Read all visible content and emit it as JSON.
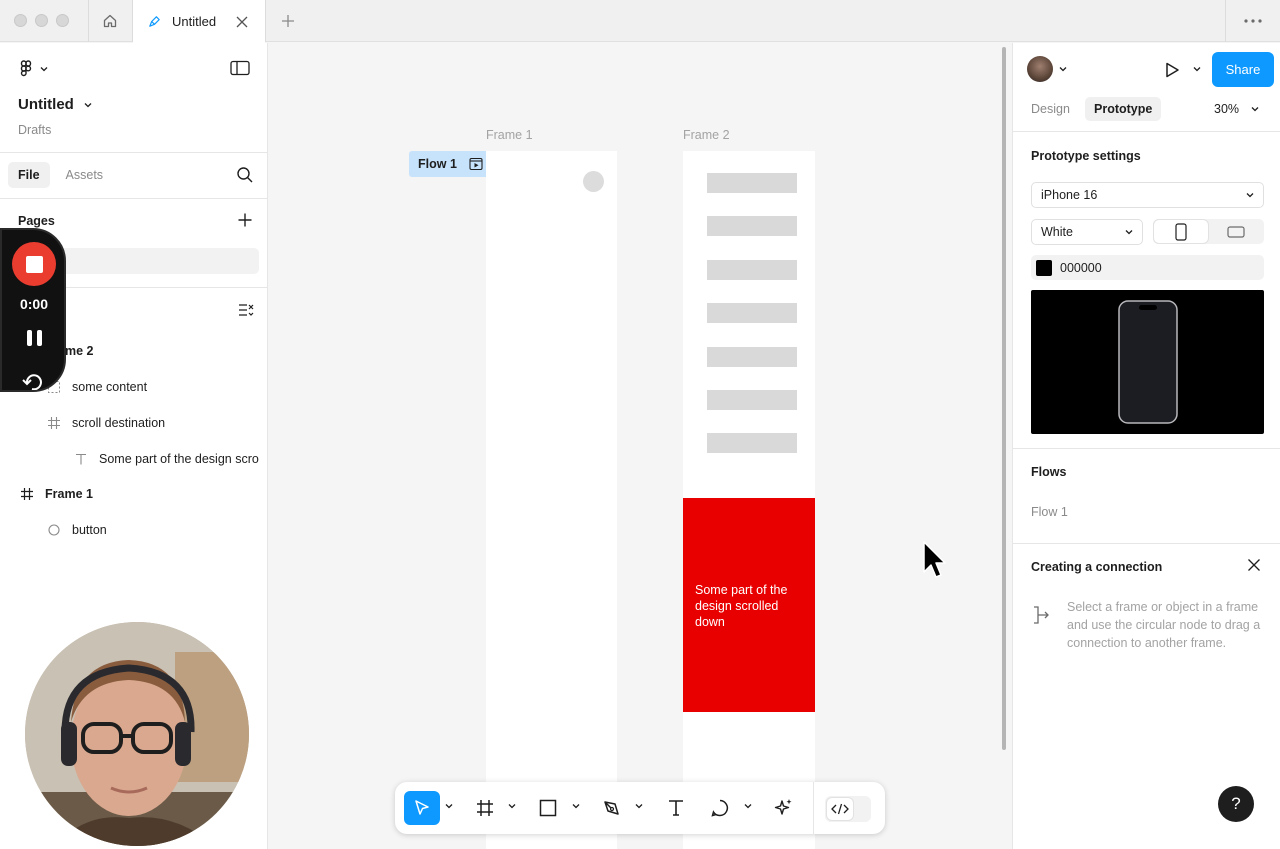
{
  "tab": {
    "title": "Untitled"
  },
  "file": {
    "name": "Untitled",
    "location": "Drafts"
  },
  "left_tabs": {
    "file": "File",
    "assets": "Assets"
  },
  "pages": {
    "label": "Pages"
  },
  "recording": {
    "time": "0:00"
  },
  "layers": [
    {
      "name": "Frame 2",
      "visible_text": "ame 2",
      "type": "frame",
      "depth": 0
    },
    {
      "name": "some content",
      "type": "section",
      "depth": 1
    },
    {
      "name": "scroll destination",
      "type": "frame",
      "depth": 1
    },
    {
      "name": "Some part of the design scrolled down",
      "visible_text": "Some part of the design scro",
      "type": "text",
      "depth": 2
    },
    {
      "name": "Frame 1",
      "type": "frame",
      "depth": 0
    },
    {
      "name": "button",
      "type": "ellipse",
      "depth": 1
    }
  ],
  "canvas": {
    "frame1_label": "Frame 1",
    "frame2_label": "Frame 2",
    "flow_chip": "Flow 1",
    "red_box_text": "Some part of the design scrolled down",
    "red_color": "#e80000"
  },
  "right": {
    "share": "Share",
    "tab_design": "Design",
    "tab_prototype": "Prototype",
    "zoom": "30%",
    "prototype_settings": "Prototype settings",
    "device": "iPhone 16",
    "model_color": "White",
    "background_hex": "000000",
    "flows_title": "Flows",
    "flow_item": "Flow 1",
    "connection_title": "Creating a connection",
    "connection_help": "Select a frame or object in a frame and use the circular node to drag a connection to another frame."
  },
  "help": "?",
  "colors": {
    "accent": "#0d99ff",
    "rec": "#ea3d30"
  },
  "icons": [
    "home-icon",
    "pen-icon",
    "close-icon",
    "plus-icon",
    "more-icon",
    "figma-logo-icon",
    "sidebar-icon",
    "search-icon",
    "frame-icon",
    "text-icon",
    "ellipse-icon",
    "play-icon",
    "cursor-icon",
    "phone-icon",
    "connection-icon"
  ]
}
